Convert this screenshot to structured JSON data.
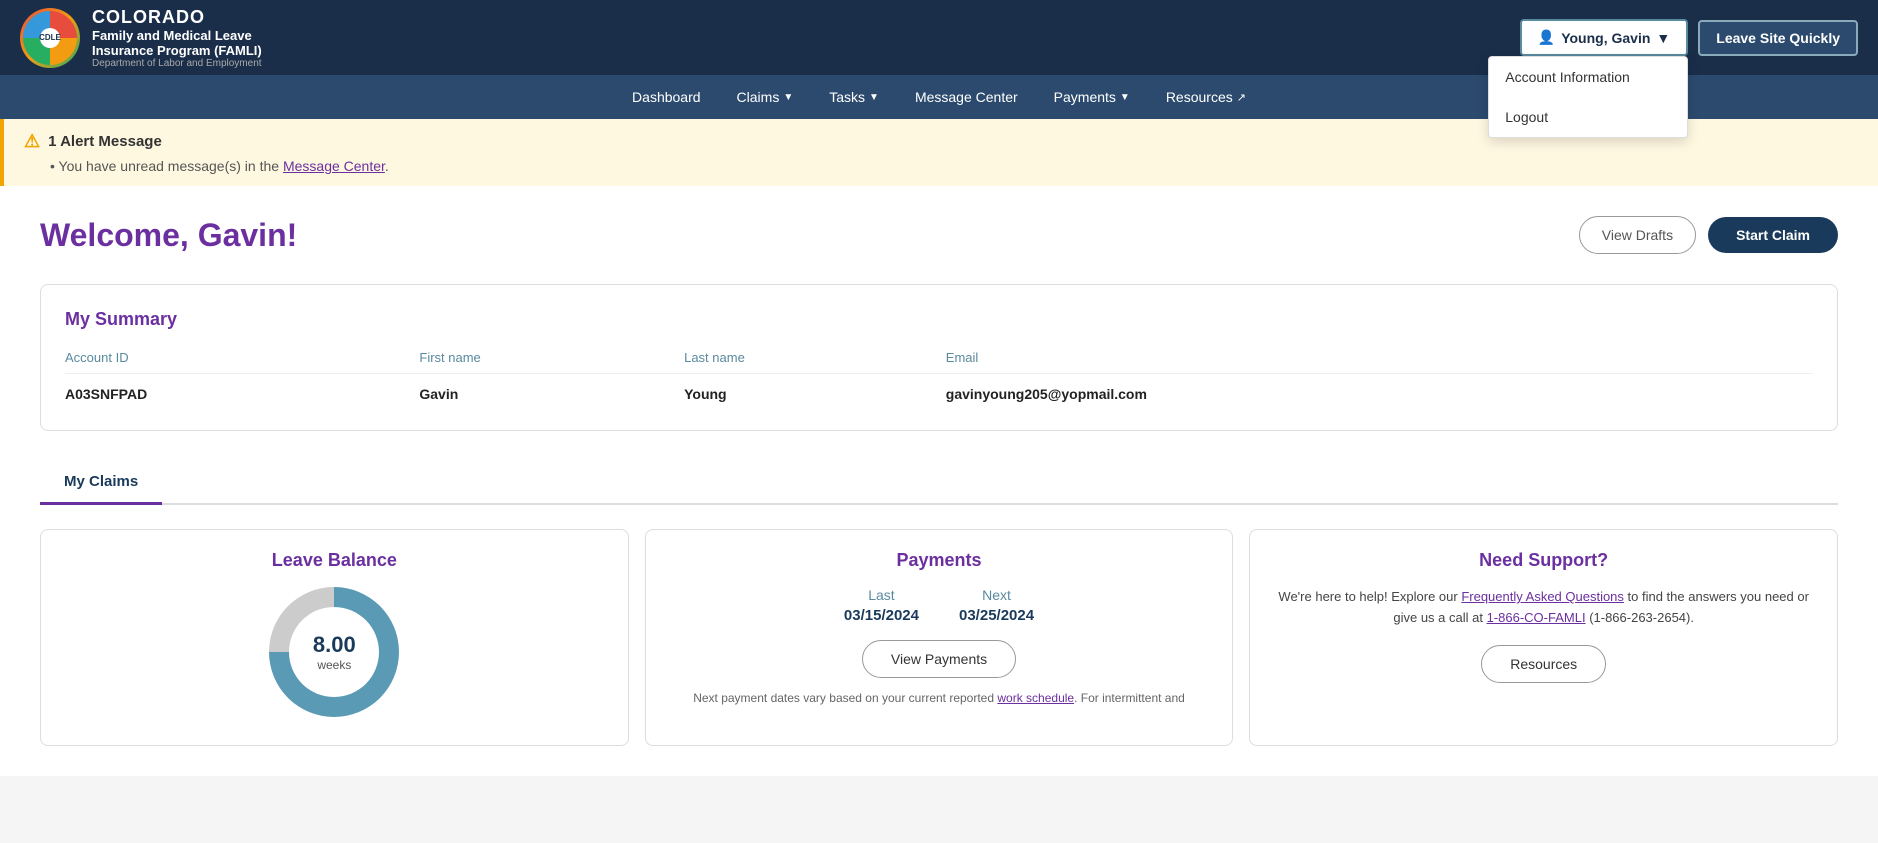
{
  "header": {
    "state": "COLORADO",
    "program_line1": "Family and Medical Leave",
    "program_line2": "Insurance Program (FAMLI)",
    "dept": "Department of Labor and Employment",
    "logo_initials": "CDLE",
    "user_name": "Young, Gavin",
    "leave_site_label": "Leave Site Quickly"
  },
  "user_dropdown": {
    "account_info_label": "Account Information",
    "logout_label": "Logout"
  },
  "nav": {
    "items": [
      {
        "label": "Dashboard",
        "has_arrow": false
      },
      {
        "label": "Claims",
        "has_arrow": true
      },
      {
        "label": "Tasks",
        "has_arrow": true
      },
      {
        "label": "Message Center",
        "has_arrow": false
      },
      {
        "label": "Payments",
        "has_arrow": true
      },
      {
        "label": "Resources",
        "has_arrow": false,
        "external": true
      }
    ]
  },
  "alert": {
    "count": "1",
    "title": "1 Alert Message",
    "body": "You have unread message(s) in the Message Center.",
    "link_text": "Message Center"
  },
  "main": {
    "welcome": "Welcome, Gavin!",
    "view_drafts_label": "View Drafts",
    "start_claim_label": "Start Claim"
  },
  "summary": {
    "title": "My Summary",
    "account_id_col": "Account ID",
    "first_name_col": "First name",
    "last_name_col": "Last name",
    "email_col": "Email",
    "account_id": "A03SNFPAD",
    "first_name": "Gavin",
    "last_name": "Young",
    "email": "gavinyoung205@yopmail.com"
  },
  "tabs": {
    "items": [
      {
        "label": "My Claims",
        "active": true
      }
    ]
  },
  "leave_balance": {
    "title": "Leave Balance",
    "weeks": "8.00",
    "weeks_label": "weeks"
  },
  "payments": {
    "title": "Payments",
    "last_label": "Last",
    "next_label": "Next",
    "last_date": "03/15/2024",
    "next_date": "03/25/2024",
    "view_payments_label": "View Payments",
    "note": "Next payment dates vary based on your current reported work schedule. For intermittent and"
  },
  "support": {
    "title": "Need Support?",
    "text": "We're here to help! Explore our",
    "faq_link": "Frequently Asked Questions",
    "text2": "to find the answers you need or give us a call at",
    "phone_link": "1-866-CO-FAMLI",
    "phone_number": "(1-866-263-2654).",
    "resources_label": "Resources"
  }
}
